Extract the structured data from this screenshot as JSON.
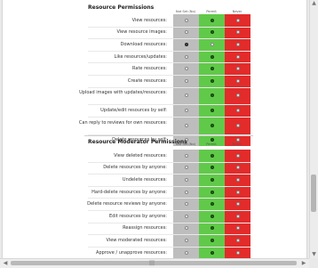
{
  "columns": {
    "not_set": "Not Set (No)",
    "permit": "Permit",
    "never": "Never"
  },
  "sections": [
    {
      "title": "Resource Permissions",
      "rows": [
        {
          "label": "View resources:",
          "value": "permit"
        },
        {
          "label": "View resource images:",
          "value": "permit"
        },
        {
          "label": "Download resources:",
          "value": "not_set"
        },
        {
          "label": "Like resources/updates:",
          "value": "permit"
        },
        {
          "label": "Rate resources:",
          "value": "permit"
        },
        {
          "label": "Create resources:",
          "value": "permit"
        },
        {
          "label": "Upload images with updates/resources:",
          "value": "permit"
        },
        {
          "label": "Update/edit resources by self:",
          "value": "permit"
        },
        {
          "label": "Can reply to reviews for own resources:",
          "value": "permit"
        },
        {
          "label": "Delete resources by self:",
          "value": "permit"
        }
      ]
    },
    {
      "title": "Resource Moderator Permissions",
      "rows": [
        {
          "label": "View deleted resources:",
          "value": "permit"
        },
        {
          "label": "Delete resources by anyone:",
          "value": "permit"
        },
        {
          "label": "Undelete resources:",
          "value": "permit"
        },
        {
          "label": "Hard-delete resources by anyone:",
          "value": "permit"
        },
        {
          "label": "Delete resource reviews by anyone:",
          "value": "permit"
        },
        {
          "label": "Edit resources by anyone:",
          "value": "permit"
        },
        {
          "label": "Reassign resources:",
          "value": "permit"
        },
        {
          "label": "View moderated resources:",
          "value": "permit"
        },
        {
          "label": "Approve / unapprove resources:",
          "value": "permit"
        }
      ]
    }
  ],
  "colors": {
    "not_set": "#bdbdbd",
    "permit": "#61c94a",
    "never": "#e22b2b"
  }
}
